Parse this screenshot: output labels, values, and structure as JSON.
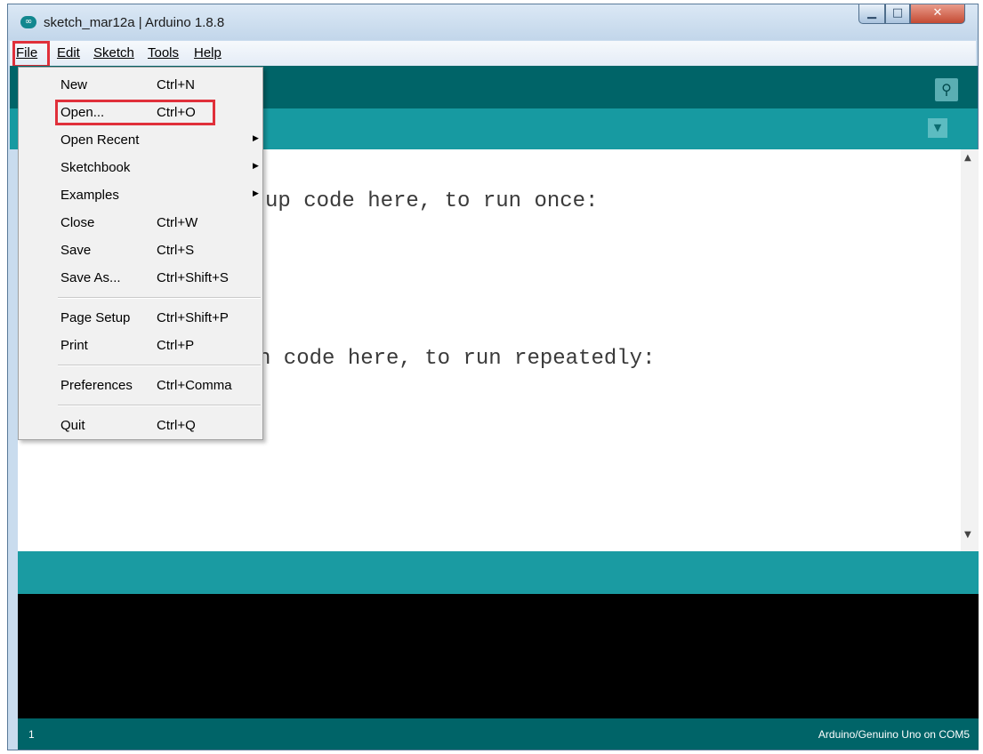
{
  "window": {
    "title": "sketch_mar12a | Arduino 1.8.8",
    "app_icon_glyph": "∞",
    "controls": {
      "minimize": "▁",
      "maximize": "□",
      "close": "✕"
    }
  },
  "menubar": {
    "items": [
      "File",
      "Edit",
      "Sketch",
      "Tools",
      "Help"
    ]
  },
  "file_menu": {
    "items": [
      {
        "label": "New",
        "shortcut": "Ctrl+N"
      },
      {
        "label": "Open...",
        "shortcut": "Ctrl+O"
      },
      {
        "label": "Open Recent",
        "submenu": "▶"
      },
      {
        "label": "Sketchbook",
        "submenu": "▶"
      },
      {
        "label": "Examples",
        "submenu": "▶"
      },
      {
        "label": "Close",
        "shortcut": "Ctrl+W"
      },
      {
        "label": "Save",
        "shortcut": "Ctrl+S"
      },
      {
        "label": "Save As...",
        "shortcut": "Ctrl+Shift+S"
      },
      {
        "label": "Page Setup",
        "shortcut": "Ctrl+Shift+P"
      },
      {
        "label": "Print",
        "shortcut": "Ctrl+P"
      },
      {
        "label": "Preferences",
        "shortcut": "Ctrl+Comma"
      },
      {
        "label": "Quit",
        "shortcut": "Ctrl+Q"
      }
    ]
  },
  "toolbar": {
    "serial_monitor_icon": "magnifier-icon",
    "serial_glyph": "⚲"
  },
  "tabbar": {
    "menu_glyph": "▼"
  },
  "editor": {
    "line1": "up code here, to run once:",
    "line2": "n code here, to run repeatedly:",
    "scroll_up": "▲",
    "scroll_down": "▼"
  },
  "footer": {
    "line_number": "1",
    "board": "Arduino/Genuino Uno on COM5"
  },
  "colors": {
    "toolbar": "#006468",
    "tabbar": "#179aa1",
    "console": "#000000",
    "highlight": "#e0303a"
  }
}
